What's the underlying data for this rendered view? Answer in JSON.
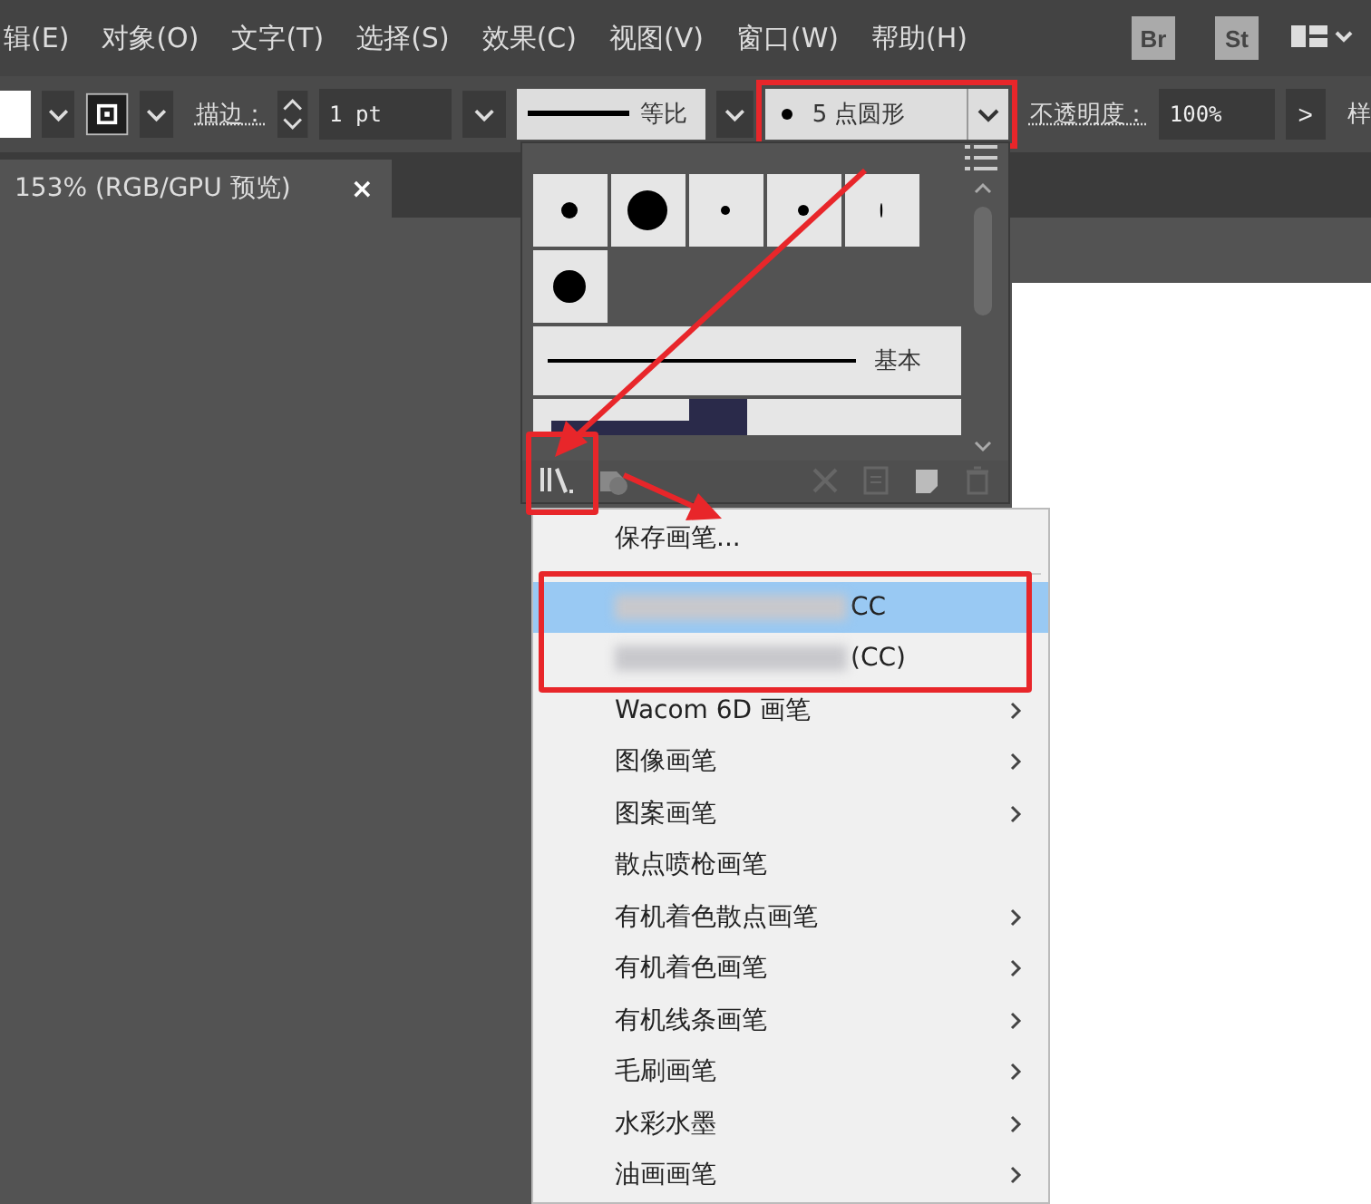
{
  "menu_bar": {
    "items": [
      "辑(E)",
      "对象(O)",
      "文字(T)",
      "选择(S)",
      "效果(C)",
      "视图(V)",
      "窗口(W)",
      "帮助(H)"
    ],
    "app_buttons": [
      "Br",
      "St"
    ]
  },
  "control_bar": {
    "stroke_label": "描边：",
    "stroke_weight": "1 pt",
    "profile": "等比",
    "brush": "5 点圆形",
    "opacity_label": "不透明度：",
    "opacity": "100%",
    "next": ">",
    "cut_label": "样"
  },
  "document_tab": {
    "title": "153% (RGB/GPU 预览)",
    "close": "×"
  },
  "brush_panel": {
    "basic_label": "基本"
  },
  "library_menu": {
    "items": [
      {
        "label": "保存画笔...",
        "redacted": false,
        "submenu": false,
        "selected": false,
        "separator_after": true
      },
      {
        "label": "CC",
        "redacted": true,
        "submenu": false,
        "selected": true,
        "separator_after": false
      },
      {
        "label": "(CC)",
        "redacted": true,
        "submenu": false,
        "selected": false,
        "separator_after": false
      },
      {
        "label": "Wacom 6D 画笔",
        "redacted": false,
        "submenu": true,
        "selected": false,
        "separator_after": false
      },
      {
        "label": "图像画笔",
        "redacted": false,
        "submenu": true,
        "selected": false,
        "separator_after": false
      },
      {
        "label": "图案画笔",
        "redacted": false,
        "submenu": true,
        "selected": false,
        "separator_after": false
      },
      {
        "label": "散点喷枪画笔",
        "redacted": false,
        "submenu": false,
        "selected": false,
        "separator_after": false
      },
      {
        "label": "有机着色散点画笔",
        "redacted": false,
        "submenu": true,
        "selected": false,
        "separator_after": false
      },
      {
        "label": "有机着色画笔",
        "redacted": false,
        "submenu": true,
        "selected": false,
        "separator_after": false
      },
      {
        "label": "有机线条画笔",
        "redacted": false,
        "submenu": true,
        "selected": false,
        "separator_after": false
      },
      {
        "label": "毛刷画笔",
        "redacted": false,
        "submenu": true,
        "selected": false,
        "separator_after": false
      },
      {
        "label": "水彩水墨",
        "redacted": false,
        "submenu": true,
        "selected": false,
        "separator_after": false
      },
      {
        "label": "油画画笔",
        "redacted": false,
        "submenu": true,
        "selected": false,
        "separator_after": false
      }
    ]
  }
}
